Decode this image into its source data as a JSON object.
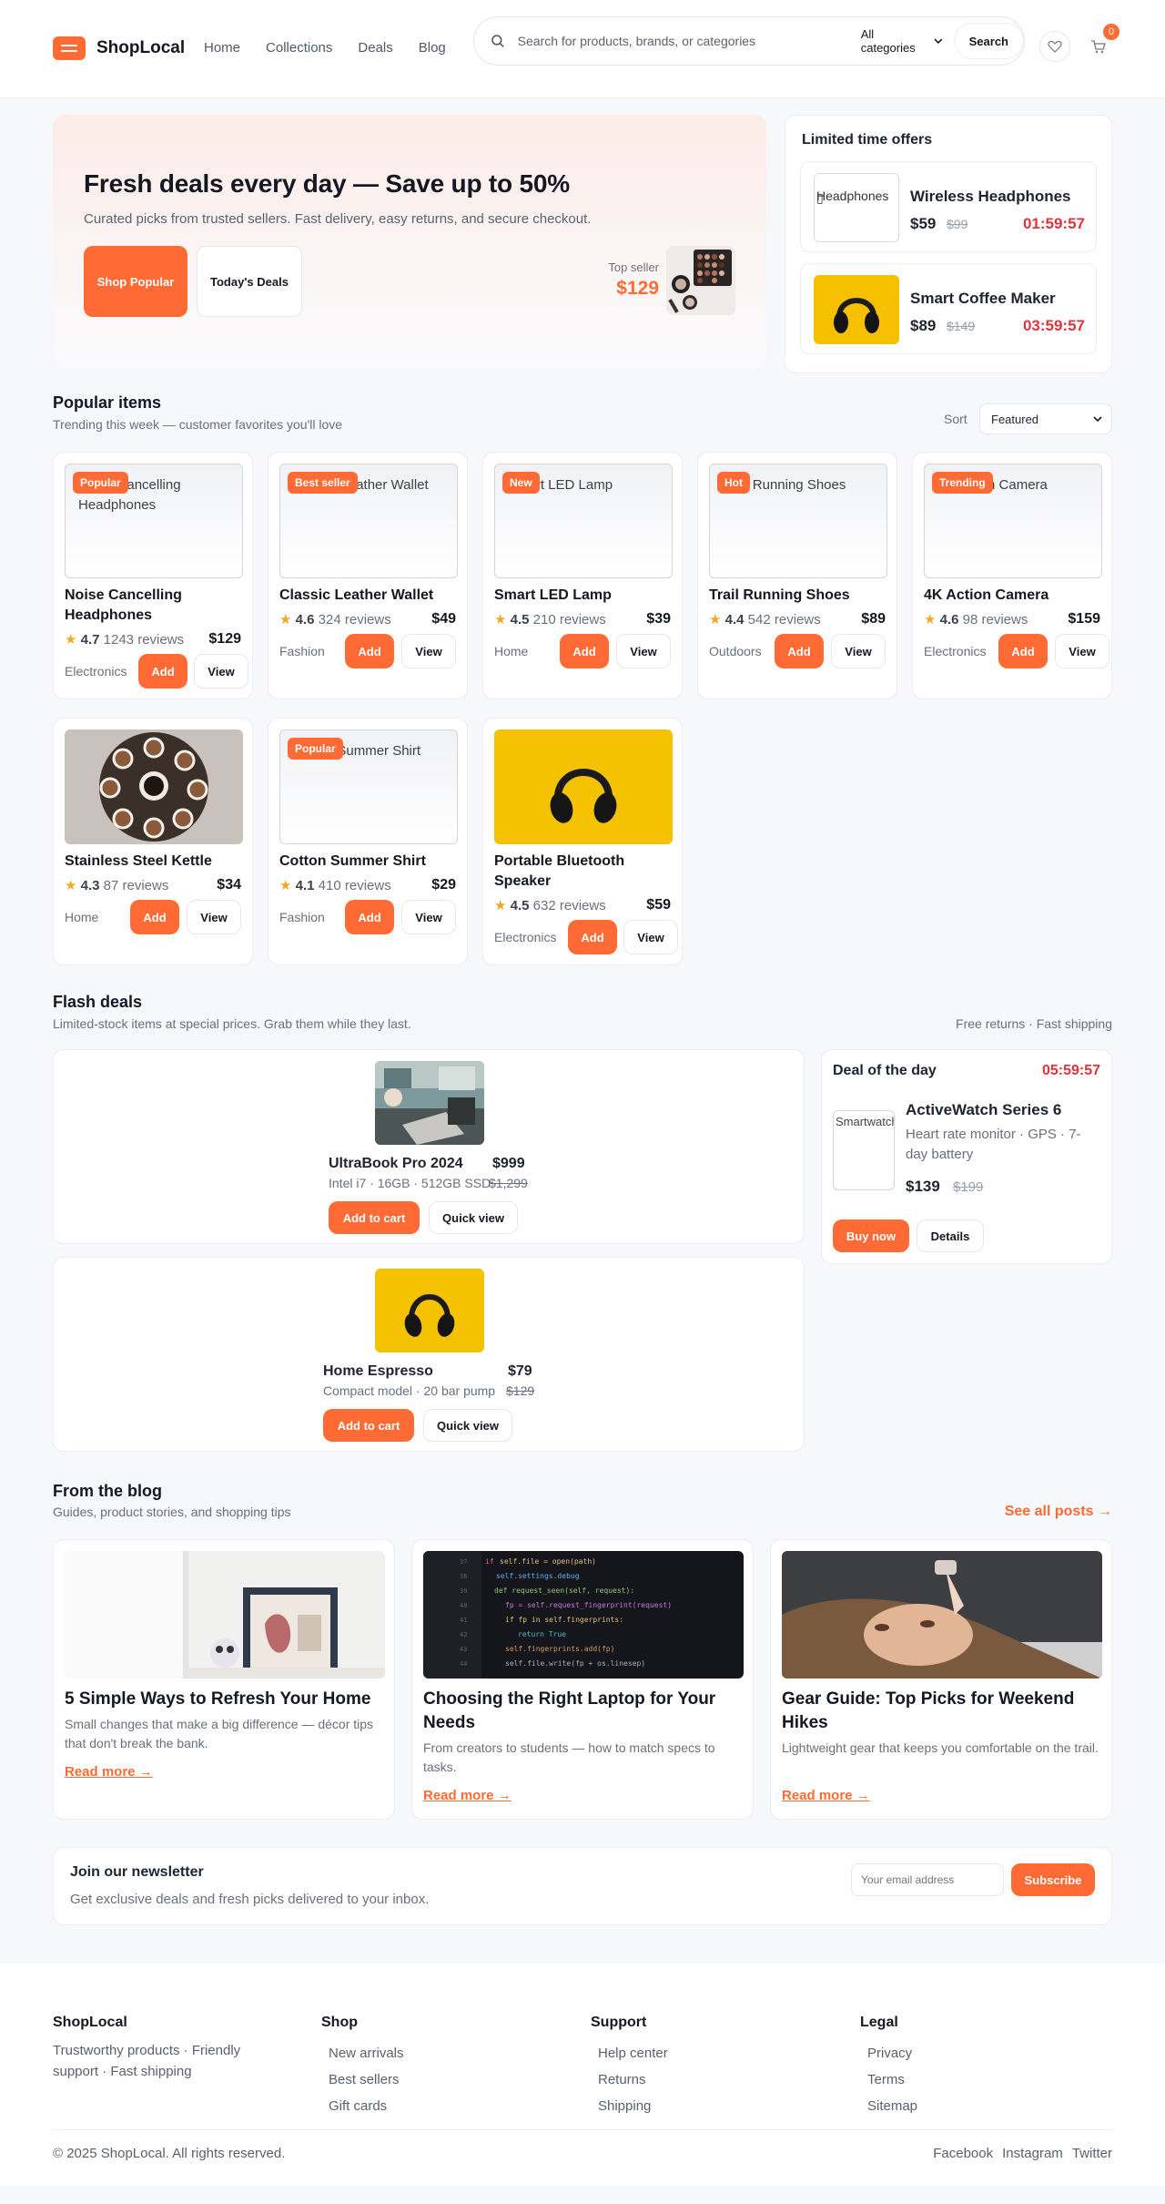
{
  "header": {
    "logo_text": "ShopLocal",
    "nav": [
      "Home",
      "Collections",
      "Deals",
      "Blog"
    ],
    "search_placeholder": "Search for products, brands, or categories",
    "category_select": "All categories",
    "search_button": "Search",
    "cart_count": "0"
  },
  "hero": {
    "title": "Fresh deals every day — Save up to 50%",
    "subtitle": "Curated picks from trusted sellers. Fast delivery, easy returns, and secure checkout.",
    "primary_button": "Shop Popular",
    "secondary_button": "Today's Deals",
    "top_seller_label": "Top seller",
    "top_seller_price": "$129"
  },
  "offers": {
    "title": "Limited time offers",
    "items": [
      {
        "thumb_alt": "Headphones",
        "name": "Wireless Headphones",
        "price": "$59",
        "old_price": "$99",
        "timer": "01:59:57"
      },
      {
        "thumb_alt": "",
        "name": "Smart Coffee Maker",
        "price": "$89",
        "old_price": "$149",
        "timer": "03:59:57"
      }
    ]
  },
  "popular": {
    "title": "Popular items",
    "subtitle": "Trending this week — customer favorites you'll love",
    "sort_label": "Sort",
    "sort_value": "Featured",
    "add_label": "Add",
    "view_label": "View",
    "products": [
      {
        "alt": "Noise Cancelling Headphones",
        "badge": "Popular",
        "name": "Noise Cancelling Headphones",
        "rating": "4.7",
        "reviews": "1243 reviews",
        "price": "$129",
        "category": "Electronics"
      },
      {
        "alt": "Classic Leather Wallet",
        "badge": "Best seller",
        "name": "Classic Leather Wallet",
        "rating": "4.6",
        "reviews": "324 reviews",
        "price": "$49",
        "category": "Fashion"
      },
      {
        "alt": "Smart LED Lamp",
        "badge": "New",
        "name": "Smart LED Lamp",
        "rating": "4.5",
        "reviews": "210 reviews",
        "price": "$39",
        "category": "Home"
      },
      {
        "alt": "Trail Running Shoes",
        "badge": "Hot",
        "name": "Trail Running Shoes",
        "rating": "4.4",
        "reviews": "542 reviews",
        "price": "$89",
        "category": "Outdoors"
      },
      {
        "alt": "4K Action Camera",
        "badge": "Trending",
        "name": "4K Action Camera",
        "rating": "4.6",
        "reviews": "98 reviews",
        "price": "$159",
        "category": "Electronics"
      },
      {
        "alt": "",
        "badge": "",
        "name": "Stainless Steel Kettle",
        "rating": "4.3",
        "reviews": "87 reviews",
        "price": "$34",
        "category": "Home"
      },
      {
        "alt": "Cotton Summer Shirt",
        "badge": "Popular",
        "name": "Cotton Summer Shirt",
        "rating": "4.1",
        "reviews": "410 reviews",
        "price": "$29",
        "category": "Fashion"
      },
      {
        "alt": "",
        "badge": "",
        "name": "Portable Bluetooth Speaker",
        "rating": "4.5",
        "reviews": "632 reviews",
        "price": "$59",
        "category": "Electronics"
      }
    ]
  },
  "flash": {
    "title": "Flash deals",
    "subtitle": "Limited-stock items at special prices. Grab them while they last.",
    "perks": "Free returns · Fast shipping",
    "add_to_cart": "Add to cart",
    "quick_view": "Quick view",
    "items": [
      {
        "name": "UltraBook Pro 2024",
        "price": "$999",
        "specs": "Intel i7 · 16GB · 512GB SSD",
        "old_price": "$1,299"
      },
      {
        "name": "Home Espresso",
        "price": "$79",
        "specs": "Compact model · 20 bar pump",
        "old_price": "$129"
      }
    ],
    "deal_of_day": {
      "title": "Deal of the day",
      "timer": "05:59:57",
      "thumb_alt": "Smartwatch",
      "name": "ActiveWatch Series 6",
      "desc": "Heart rate monitor · GPS · 7-day battery",
      "price": "$139",
      "old_price": "$199",
      "buy": "Buy now",
      "details": "Details"
    }
  },
  "blog": {
    "title": "From the blog",
    "subtitle": "Guides, product stories, and shopping tips",
    "see_all": "See all posts →",
    "read_more": "Read more →",
    "posts": [
      {
        "title": "5 Simple Ways to Refresh Your Home",
        "desc": "Small changes that make a big difference — décor tips that don't break the bank."
      },
      {
        "title": "Choosing the Right Laptop for Your Needs",
        "desc": "From creators to students — how to match specs to tasks."
      },
      {
        "title": "Gear Guide: Top Picks for Weekend Hikes",
        "desc": "Lightweight gear that keeps you comfortable on the trail."
      }
    ]
  },
  "newsletter": {
    "title": "Join our newsletter",
    "subtitle": "Get exclusive deals and fresh picks delivered to your inbox.",
    "placeholder": "Your email address",
    "button": "Subscribe"
  },
  "footer": {
    "brand": "ShopLocal",
    "tagline": "Trustworthy products · Friendly support · Fast shipping",
    "columns": [
      {
        "title": "Shop",
        "links": [
          "New arrivals",
          "Best sellers",
          "Gift cards"
        ]
      },
      {
        "title": "Support",
        "links": [
          "Help center",
          "Returns",
          "Shipping"
        ]
      },
      {
        "title": "Legal",
        "links": [
          "Privacy",
          "Terms",
          "Sitemap"
        ]
      }
    ],
    "copyright": "© 2025 ShopLocal. All rights reserved.",
    "social": [
      "Facebook",
      "Instagram",
      "Twitter"
    ]
  },
  "colors": {
    "accent": "#ff6a35",
    "timer": "#e0343d",
    "star": "#f5a623"
  }
}
